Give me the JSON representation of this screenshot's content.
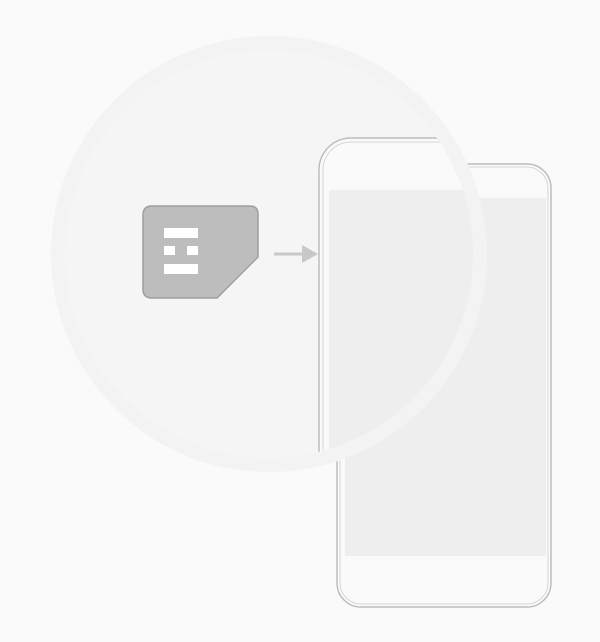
{
  "screen": {
    "illustration": "insert-sim-card",
    "icons": [
      "sim-card-icon",
      "arrow-right-icon",
      "phone-icon"
    ],
    "colors": {
      "background": "#fafafa",
      "magnifier_fill": "#f5f5f5",
      "magnifier_ring": "#f3f3f3",
      "phone_outline": "#bdbdbd",
      "phone_screen": "#eeeeee",
      "sim_fill": "#bdbdbd",
      "sim_stroke": "#9e9e9e",
      "sim_contacts": "#ffffff",
      "arrow": "#c8c8c8"
    }
  }
}
